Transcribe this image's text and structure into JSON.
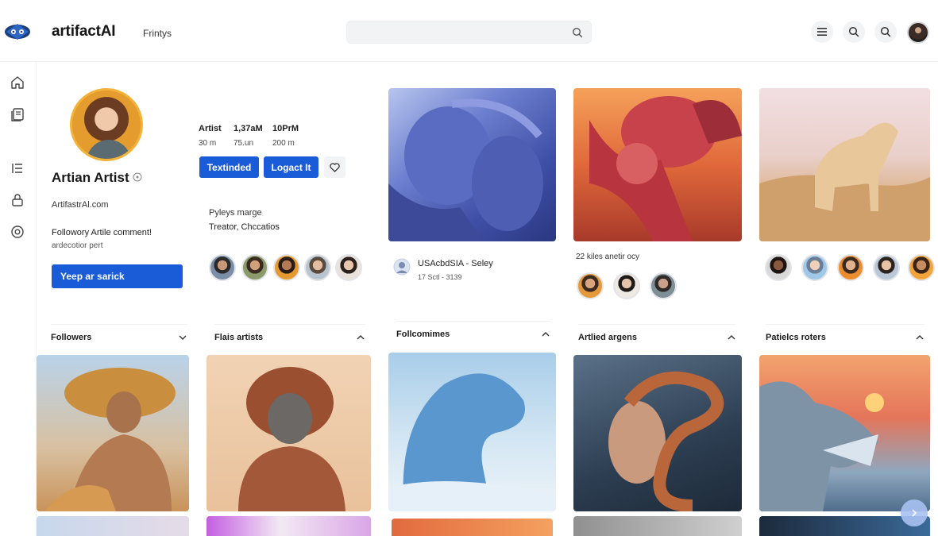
{
  "app": {
    "brand": "artifactAI",
    "nav_link": "Frintys",
    "search_placeholder": ""
  },
  "profile": {
    "name": "Artian Artist",
    "site": "ArtifastrAl.com",
    "bio_line1": "Followory Artile comment!",
    "bio_line2": "ardecotior pert",
    "cta_label": "Yeep ar sarick",
    "stats": {
      "labels": [
        "Artist",
        "1,37aM",
        "10PrM"
      ],
      "values": [
        "30 m",
        "75.un",
        "200 m"
      ]
    },
    "btn_primary": "Textinded",
    "btn_secondary": "Logact It",
    "meta_line1": "Pyleys marge",
    "meta_line2": "Treator, Chccatios"
  },
  "feed": {
    "tile2_caption": "USAcbdSIA - Seley",
    "tile2_sub": "17 Sctl - 3139",
    "tile3_caption": "22 kiles anetir ocy"
  },
  "sections": [
    {
      "label": "Followers",
      "chevron": "chevron-down-icon"
    },
    {
      "label": "Flais artists",
      "chevron": "chevron-up-icon"
    },
    {
      "label": "Follcomimes",
      "chevron": "chevron-up-icon"
    },
    {
      "label": "Artlied argens",
      "chevron": "chevron-up-icon"
    },
    {
      "label": "Patielcs roters",
      "chevron": "chevron-up-icon"
    }
  ],
  "colors": {
    "accent": "#1a5bd8",
    "surface": "#f2f3f5"
  }
}
